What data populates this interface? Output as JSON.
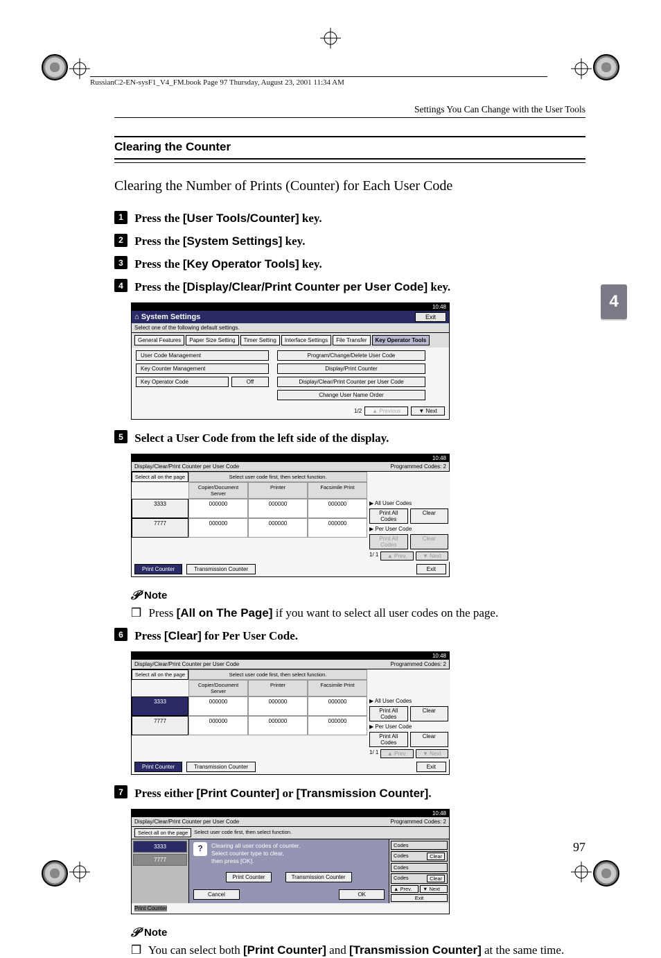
{
  "doc_header": "RussianC2-EN-sysF1_V4_FM.book  Page 97  Thursday, August 23, 2001  11:34 AM",
  "running_head": "Settings You Can Change with the User Tools",
  "section_title": "Clearing the Counter",
  "subtitle": "Clearing the Number of Prints (Counter) for Each User Code",
  "chapter_tab": "4",
  "page_number": "97",
  "steps": {
    "s1": {
      "num": "1",
      "lead": "Press the ",
      "ui": "[User Tools/Counter]",
      "tail": " key."
    },
    "s2": {
      "num": "2",
      "lead": "Press the ",
      "ui": "[System Settings]",
      "tail": " key."
    },
    "s3": {
      "num": "3",
      "lead": "Press the ",
      "ui": "[Key Operator Tools]",
      "tail": " key."
    },
    "s4": {
      "num": "4",
      "lead": "Press the ",
      "ui": "[Display/Clear/Print Counter per User Code]",
      "tail": " key."
    },
    "s5": {
      "num": "5",
      "text": "Select a User Code from the left side of the display."
    },
    "s6": {
      "num": "6",
      "lead": "Press ",
      "ui": "[Clear]",
      "tail": " for Per User Code."
    },
    "s7": {
      "num": "7",
      "lead": "Press either ",
      "ui1": "[Print Counter]",
      "mid": " or ",
      "ui2": "[Transmission Counter]",
      "tail": "."
    }
  },
  "notes": {
    "label": "Note",
    "n1_pre": "Press ",
    "n1_ui": "[All on The Page]",
    "n1_post": " if you want to select all user codes on the page.",
    "n2_pre": "You can select both ",
    "n2_ui1": "[Print Counter]",
    "n2_mid": " and ",
    "n2_ui2": "[Transmission Counter]",
    "n2_post": " at the same time."
  },
  "sys": {
    "bar_right": "10:48",
    "title": "System Settings",
    "exit": "Exit",
    "sub": "Select one of the following default settings.",
    "tabs": [
      "General Features",
      "Paper Size Setting",
      "Timer Setting",
      "Interface Settings",
      "File Transfer",
      "Key Operator Tools"
    ],
    "left_rows": [
      "User Code Management",
      "Key Counter Management",
      "Key Operator Code"
    ],
    "left_val": "Off",
    "right_rows": [
      "Program/Change/Delete User Code",
      "Display/Print Counter",
      "Display/Clear/Print Counter per User Code",
      "Change User Name Order"
    ],
    "page_ind": "1/2",
    "prev": "▲ Previous",
    "next": "▼ Next"
  },
  "ctr": {
    "title": "Display/Clear/Print Counter per User Code",
    "programmed": "Programmed Codes:",
    "programmed_n": "2",
    "select_all": "Select all on the page",
    "hint": "Select user code first, then select function.",
    "cols": [
      "Copier/Document Server",
      "Printer",
      "Facsimile Print"
    ],
    "rows": [
      {
        "code": "3333",
        "v": [
          "000000",
          "000000",
          "000000"
        ]
      },
      {
        "code": "7777",
        "v": [
          "000000",
          "000000",
          "000000"
        ]
      }
    ],
    "all_label": "▶ All User Codes",
    "per_label": "▶ Per User Code",
    "print_all": "Print All Codes",
    "clear": "Clear",
    "page_ind": "1/  1",
    "prev": "▲ Prev.",
    "next": "▼ Next",
    "print_counter": "Print Counter",
    "trans_counter": "Transmission Counter",
    "exit": "Exit"
  },
  "dlg": {
    "msg1": "Clearing all user codes of counter.",
    "msg2": "Select counter type to clear,",
    "msg3": "then press [OK].",
    "print_counter": "Print Counter",
    "trans_counter": "Transmission Counter",
    "cancel": "Cancel",
    "ok": "OK",
    "codes_label": "Codes",
    "clear": "Clear"
  }
}
